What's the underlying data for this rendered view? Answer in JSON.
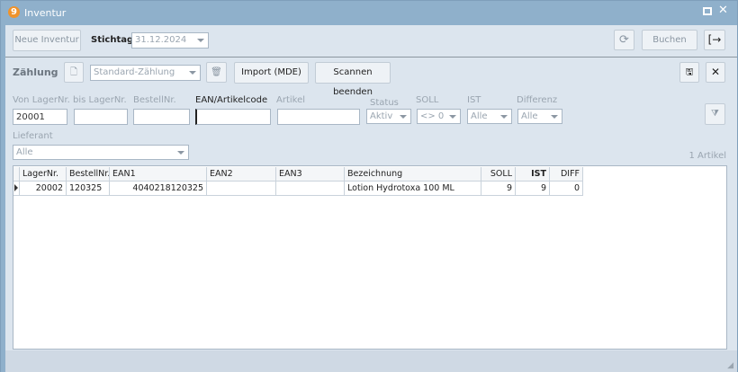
{
  "window": {
    "title": "Inventur",
    "logo": "9"
  },
  "toolbar": {
    "new_inventory": "Neue Inventur",
    "stichtag_label": "Stichtag:",
    "stichtag_value": "31.12.2024",
    "book": "Buchen"
  },
  "count": {
    "label": "Zählung",
    "type_value": "Standard-Zählung",
    "import": "Import (MDE)",
    "stop_scan": "Scannen beenden"
  },
  "filters": {
    "von_label": "Von LagerNr.",
    "von_value": "20001",
    "bis_label": "bis LagerNr.",
    "bestell_label": "BestellNr.",
    "ean_label": "EAN/Artikelcode",
    "artikel_label": "Artikel",
    "status_label": "Status",
    "status_value": "Aktiv",
    "soll_label": "SOLL",
    "soll_value": "<> 0",
    "ist_label": "IST",
    "ist_value": "Alle",
    "diff_label": "Differenz",
    "diff_value": "Alle",
    "lieferant_label": "Lieferant",
    "lieferant_value": "Alle"
  },
  "count_text": "1 Artikel",
  "table": {
    "headers": [
      "LagerNr.",
      "BestellNr.",
      "EAN1",
      "EAN2",
      "EAN3",
      "Bezeichnung",
      "SOLL",
      "IST",
      "DIFF"
    ],
    "rows": [
      [
        "20002",
        "120325",
        "4040218120325",
        "",
        "",
        "Lotion Hydrotoxa 100 ML",
        "9",
        "9",
        "0"
      ]
    ]
  }
}
